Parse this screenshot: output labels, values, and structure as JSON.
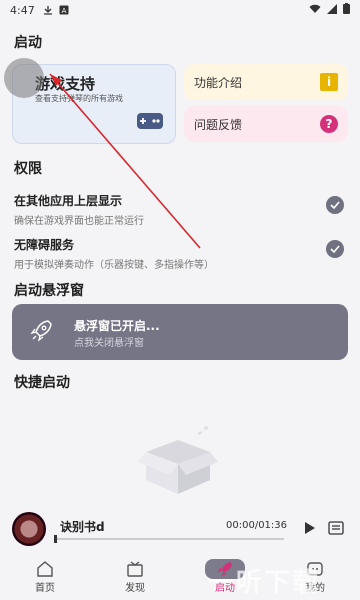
{
  "status_bar": {
    "time": "4:47"
  },
  "sections": {
    "launch": "启动",
    "permissions": "权限",
    "floating": "启动悬浮窗",
    "shortcut": "快捷启动"
  },
  "game_card": {
    "title": "游戏支持",
    "subtitle": "查看支持弹琴的所有游戏"
  },
  "intro_card": {
    "label": "功能介绍",
    "badge": "i"
  },
  "feedback_card": {
    "label": "问题反馈",
    "badge": "?"
  },
  "permissions": [
    {
      "title": "在其他应用上层显示",
      "desc": "确保在游戏界面也能正常运行"
    },
    {
      "title": "无障碍服务",
      "desc": "用于模拟弹奏动作（乐器按键、多指操作等）"
    }
  ],
  "floating_card": {
    "title": "悬浮窗已开启...",
    "subtitle": "点我关闭悬浮窗"
  },
  "player": {
    "song": "诀别书d",
    "time": "00:00/01:36",
    "progress": 0.0
  },
  "nav": [
    {
      "label": "首页"
    },
    {
      "label": "发现"
    },
    {
      "label": "启动"
    },
    {
      "label": "我的"
    }
  ],
  "colors": {
    "accent": "#d4317a",
    "float_card": "#767586",
    "info_badge": "#e7b400"
  }
}
